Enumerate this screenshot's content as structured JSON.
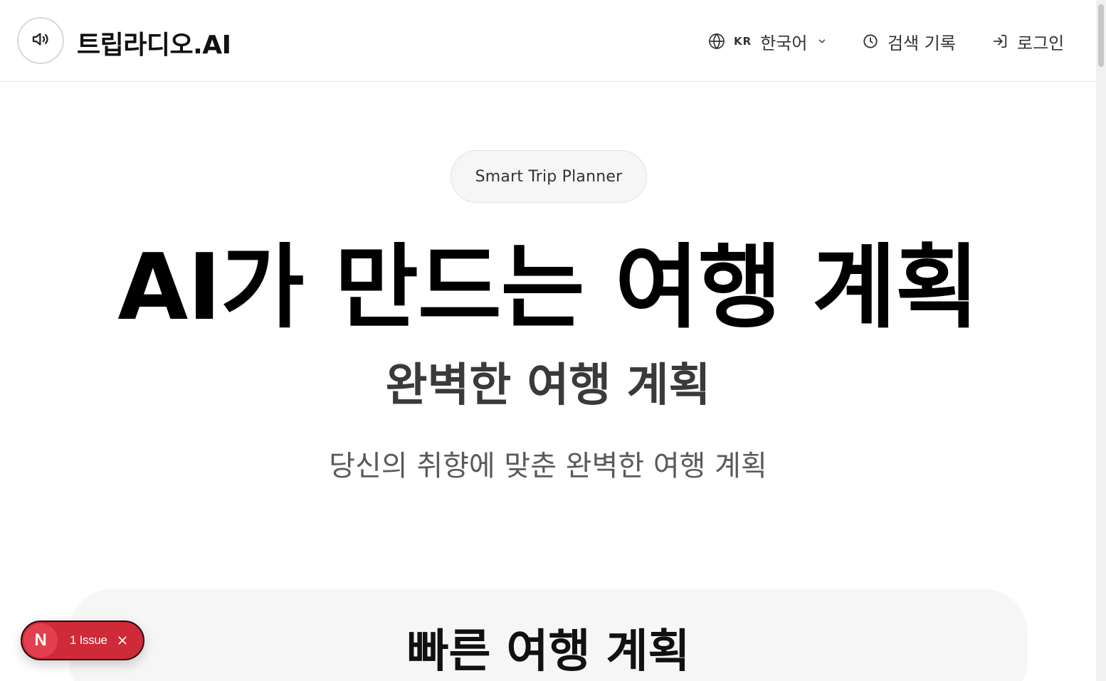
{
  "header": {
    "brand": "트립라디오.AI",
    "sound_icon": "speaker-volume-icon",
    "language": {
      "icon": "globe-icon",
      "code": "KR",
      "label": "한국어",
      "chevron_icon": "chevron-down-icon"
    },
    "history": {
      "icon": "clock-icon",
      "label": "검색 기록"
    },
    "login": {
      "icon": "login-arrow-icon",
      "label": "로그인"
    }
  },
  "hero": {
    "pill": "Smart Trip Planner",
    "title": "AI가 만드는 여행 계획",
    "subtitle": "완벽한 여행 계획",
    "description": "당신의 취향에 맞춘 완벽한 여행 계획"
  },
  "quick_plan": {
    "title": "빠른 여행 계획"
  },
  "dev_overlay": {
    "logo_letter": "N",
    "issue_label": "1 Issue",
    "close_icon": "close-icon",
    "color": "#cf2a38"
  }
}
